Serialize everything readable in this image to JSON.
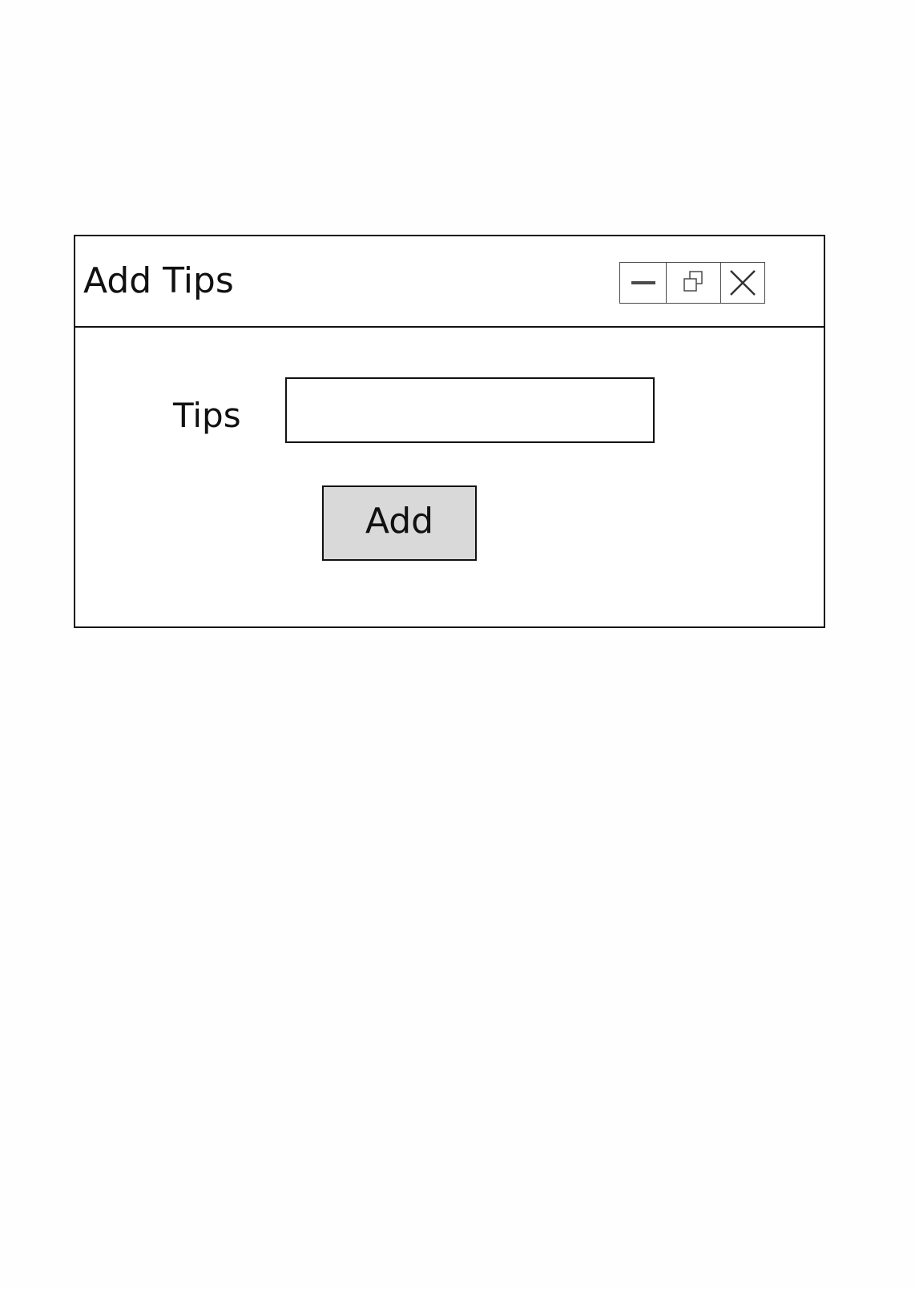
{
  "window": {
    "title": "Add Tips",
    "controls": {
      "minimize": "minimize-icon",
      "restore": "restore-icon",
      "close": "close-icon"
    }
  },
  "form": {
    "tips_label": "Tips",
    "tips_value": "",
    "tips_placeholder": "",
    "add_button_label": "Add"
  },
  "colors": {
    "border": "#111111",
    "button_background": "#d9d9d9",
    "control_border": "#4a4a4a",
    "page_background": "#fefefe"
  }
}
